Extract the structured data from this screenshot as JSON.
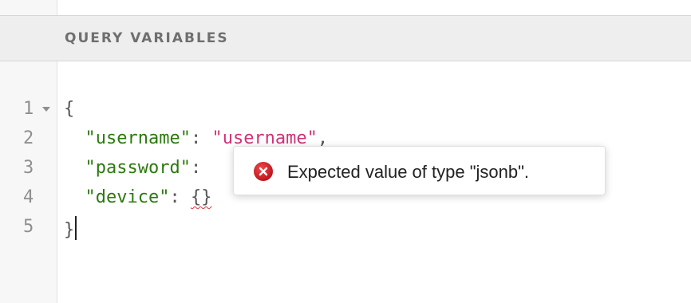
{
  "query_variables": {
    "title": "QUERY VARIABLES"
  },
  "editor": {
    "line_numbers": [
      "1",
      "2",
      "3",
      "4",
      "5"
    ],
    "lines": [
      {
        "segments": [
          {
            "t": "{",
            "c": "p"
          }
        ]
      },
      {
        "segments": [
          {
            "t": "  "
          },
          {
            "t": "\"username\"",
            "c": "k"
          },
          {
            "t": ": ",
            "c": "p"
          },
          {
            "t": "\"username\"",
            "c": "s"
          },
          {
            "t": ",",
            "c": "p"
          }
        ]
      },
      {
        "segments": [
          {
            "t": "  "
          },
          {
            "t": "\"password\"",
            "c": "k"
          },
          {
            "t": ":",
            "c": "p"
          }
        ]
      },
      {
        "segments": [
          {
            "t": "  "
          },
          {
            "t": "\"device\"",
            "c": "k"
          },
          {
            "t": ": ",
            "c": "p"
          },
          {
            "t": "{}",
            "c": "p err"
          }
        ]
      },
      {
        "segments": [
          {
            "t": "}",
            "c": "p"
          }
        ],
        "cursor": true
      }
    ]
  },
  "tooltip": {
    "icon": "error-circle-icon",
    "message": "Expected value of type \"jsonb\"."
  },
  "colors": {
    "key": "#2c7a0e",
    "string": "#d1327a",
    "error": "#e0323a",
    "header_bg": "#eeeeee"
  }
}
